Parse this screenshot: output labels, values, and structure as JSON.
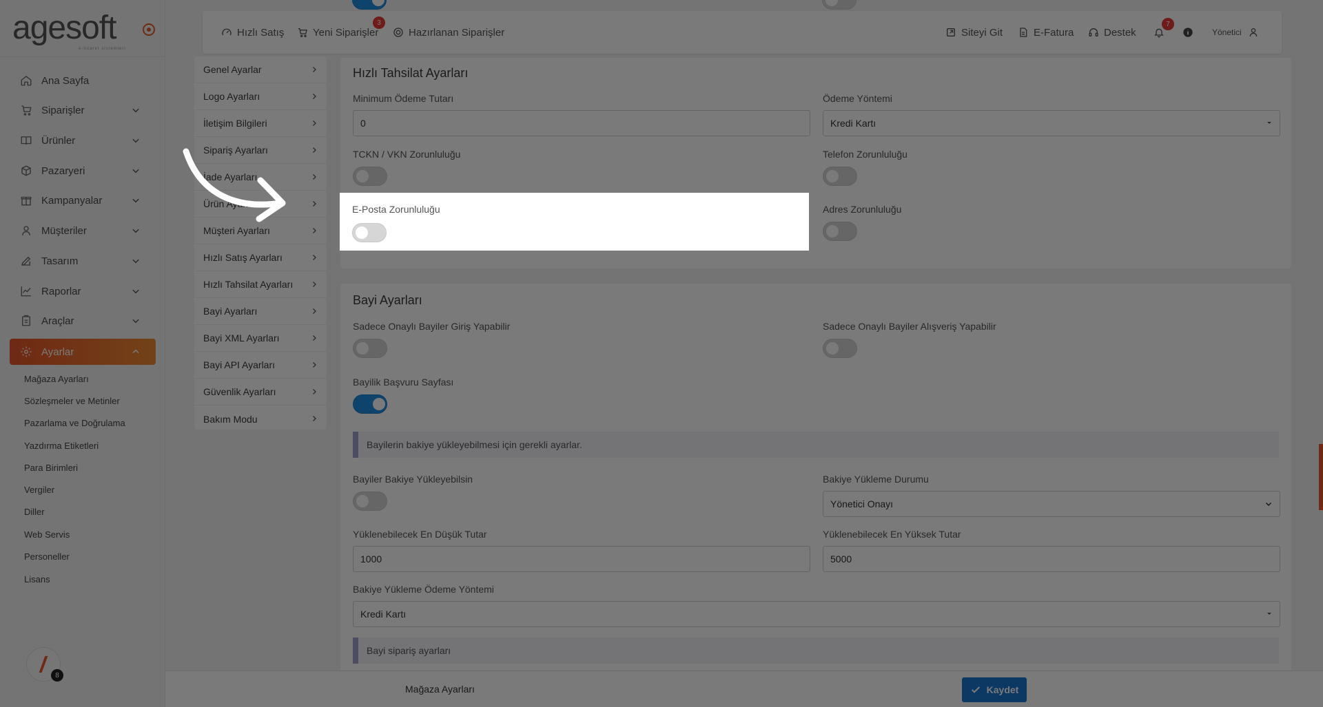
{
  "sidebar": {
    "brand": "agesoft",
    "brand_tagline": "e-ticaret sistemleri",
    "nav": [
      {
        "label": "Ana Sayfa",
        "icon": "home-icon"
      },
      {
        "label": "Siparişler",
        "icon": "cart-icon"
      },
      {
        "label": "Ürünler",
        "icon": "book-icon"
      },
      {
        "label": "Pazaryeri",
        "icon": "box-icon"
      },
      {
        "label": "Kampanyalar",
        "icon": "gift-icon"
      },
      {
        "label": "Müşteriler",
        "icon": "user-icon"
      },
      {
        "label": "Tasarım",
        "icon": "brush-icon"
      },
      {
        "label": "Raporlar",
        "icon": "chart-icon"
      },
      {
        "label": "Araçlar",
        "icon": "clipboard-icon"
      },
      {
        "label": "Ayarlar",
        "icon": "gear-icon",
        "active": true
      }
    ],
    "sub_items": [
      "Mağaza Ayarları",
      "Sözleşmeler ve Metinler",
      "Pazarlama ve Doğrulama",
      "Yazdırma Etiketleri",
      "Para Birimleri",
      "Vergiler",
      "Diller",
      "Web Servis",
      "Personeller",
      "Lisans"
    ],
    "avatar_badge": "8"
  },
  "topbar": {
    "quick_sale": "Hızlı Satış",
    "new_orders": "Yeni Siparişler",
    "new_orders_badge": "3",
    "prepared_orders": "Hazırlanan Siparişler",
    "visit_site": "Siteyi Git",
    "e_invoice": "E-Fatura",
    "support": "Destek",
    "notifications_badge": "7",
    "user": "Yönetici"
  },
  "settings_menu": [
    "Genel Ayarlar",
    "Logo Ayarları",
    "İletişim Bilgileri",
    "Sipariş Ayarları",
    "İade Ayarları",
    "Ürün Ayarları",
    "Müşteri Ayarları",
    "Hızlı Satış Ayarları",
    "Hızlı Tahsilat Ayarları",
    "Bayi Ayarları",
    "Bayi XML Ayarları",
    "Bayi API Ayarları",
    "Güvenlik Ayarları",
    "Bakım Modu"
  ],
  "quick_collection": {
    "title": "Hızlı Tahsilat Ayarları",
    "min_payment_label": "Minimum Ödeme Tutarı",
    "min_payment_value": "0",
    "payment_method_label": "Ödeme Yöntemi",
    "payment_method_value": "Kredi Kartı",
    "tckn_label": "TCKN / VKN Zorunluluğu",
    "phone_label": "Telefon Zorunluluğu",
    "email_label": "E-Posta Zorunluluğu",
    "address_label": "Adres Zorunluluğu",
    "toggles": {
      "tckn": false,
      "phone": false,
      "email": false,
      "address": false
    }
  },
  "dealer": {
    "title": "Bayi Ayarları",
    "approved_login_label": "Sadece Onaylı Bayiler Giriş Yapabilir",
    "approved_shopping_label": "Sadece Onaylı Bayiler Alışveriş Yapabilir",
    "application_page_label": "Bayilik Başvuru Sayfası",
    "balance_note": "Bayilerin bakiye yükleyebilmesi için gerekli ayarlar.",
    "can_load_balance_label": "Bayiler Bakiye Yükleyebilsin",
    "balance_status_label": "Bakiye Yükleme Durumu",
    "balance_status_value": "Yönetici Onayı",
    "min_amount_label": "Yüklenebilecek En Düşük Tutar",
    "min_amount_value": "1000",
    "max_amount_label": "Yüklenebilecek En Yüksek Tutar",
    "max_amount_value": "5000",
    "balance_payment_label": "Bakiye Yükleme Ödeme Yöntemi",
    "balance_payment_value": "Kredi Kartı",
    "order_note": "Bayi sipariş ayarları",
    "toggles": {
      "approved_login": false,
      "approved_shopping": false,
      "application_page": true,
      "can_load_balance": false
    }
  },
  "bottombar": {
    "title": "Mağaza Ayarları",
    "save_label": "Kaydet"
  }
}
